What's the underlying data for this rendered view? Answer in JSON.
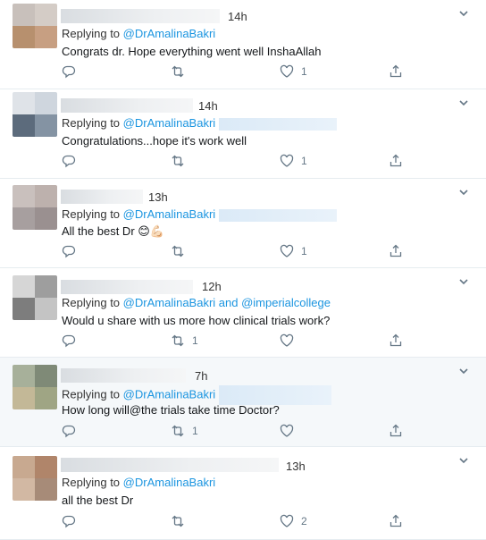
{
  "colors": {
    "link": "#1b95e0",
    "icon": "#657786",
    "divider": "#e6ecf0",
    "highlight_bg": "#f5f8fa"
  },
  "icons": {
    "reply": "reply-icon",
    "retweet": "retweet-icon",
    "like": "heart-icon",
    "share": "share-icon",
    "menu": "chevron-down-icon"
  },
  "replies": [
    {
      "time": "14h",
      "replying_prefix": "Replying to",
      "mentions": "@DrAmalinaBakri",
      "text": "Congrats dr. Hope everything went well InshaAllah",
      "retweets": "",
      "likes": "1"
    },
    {
      "time": "14h",
      "replying_prefix": "Replying to",
      "mentions": "@DrAmalinaBakri",
      "text": "Congratulations...hope it's work well",
      "retweets": "",
      "likes": "1"
    },
    {
      "time": "13h",
      "replying_prefix": "Replying to",
      "mentions": "@DrAmalinaBakri",
      "text": "All the best Dr 😊💪🏻",
      "retweets": "",
      "likes": "1"
    },
    {
      "time": "12h",
      "replying_prefix": "Replying to",
      "mentions": "@DrAmalinaBakri and @imperialcollege",
      "text": "Would u share with us more how clinical trials work?",
      "retweets": "1",
      "likes": ""
    },
    {
      "time": "7h",
      "replying_prefix": "Replying to",
      "mentions": "@DrAmalinaBakri",
      "text": "How long will@the trials take time Doctor?",
      "retweets": "1",
      "likes": ""
    },
    {
      "time": "13h",
      "replying_prefix": "Replying to",
      "mentions": "@DrAmalinaBakri",
      "text": "all the best Dr",
      "retweets": "",
      "likes": "2"
    }
  ]
}
